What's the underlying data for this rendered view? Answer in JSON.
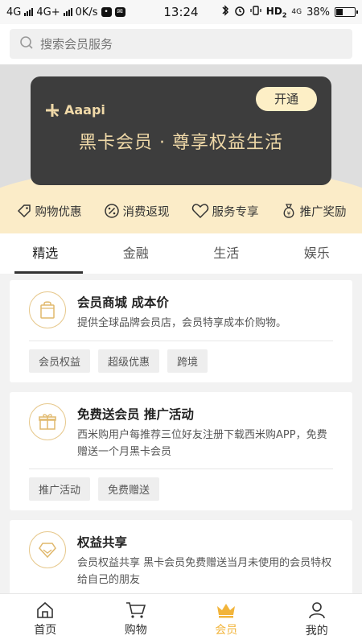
{
  "status_bar": {
    "network_1": "4G",
    "network_2": "4G+",
    "speed": "0K/s",
    "time": "13:24",
    "hd_label": "HD",
    "hd_sub": "2",
    "net_small": "4G",
    "battery_level": 0.38,
    "battery": "38%"
  },
  "search": {
    "placeholder": "搜索会员服务"
  },
  "hero": {
    "brand": "Aaapi",
    "open_button": "开通",
    "title": "黑卡会员 · 尊享权益生活"
  },
  "benefits": [
    {
      "label": "购物优惠",
      "icon": "tag-icon"
    },
    {
      "label": "消费返现",
      "icon": "percent-icon"
    },
    {
      "label": "服务专享",
      "icon": "heart-icon"
    },
    {
      "label": "推广奖励",
      "icon": "money-bag-icon"
    }
  ],
  "tabs": [
    {
      "label": "精选",
      "active": true
    },
    {
      "label": "金融",
      "active": false
    },
    {
      "label": "生活",
      "active": false
    },
    {
      "label": "娱乐",
      "active": false
    }
  ],
  "items": [
    {
      "title": "会员商城 成本价",
      "desc": "提供全球品牌会员店，会员特享成本价购物。",
      "icon": "shopping-bag-icon",
      "tags": [
        "会员权益",
        "超级优惠",
        "跨境"
      ]
    },
    {
      "title": "免费送会员 推广活动",
      "desc": "西米购用户每推荐三位好友注册下载西米购APP，免费赠送一个月黑卡会员",
      "icon": "gift-icon",
      "tags": [
        "推广活动",
        "免费赠送"
      ]
    },
    {
      "title": "权益共享",
      "desc": "会员权益共享 黑卡会员免费赠送当月未使用的会员特权给自己的朋友",
      "icon": "diamond-icon",
      "tags": []
    }
  ],
  "bottom_nav": [
    {
      "label": "首页",
      "icon": "home-icon",
      "active": false
    },
    {
      "label": "购物",
      "icon": "cart-icon",
      "active": false
    },
    {
      "label": "会员",
      "icon": "crown-icon",
      "active": true
    },
    {
      "label": "我的",
      "icon": "user-icon",
      "active": false
    }
  ],
  "colors": {
    "accent_gold": "#f2b43a",
    "card_bg": "#3d3d3d",
    "card_text": "#f0d9a8",
    "cream": "#fbecc8"
  }
}
